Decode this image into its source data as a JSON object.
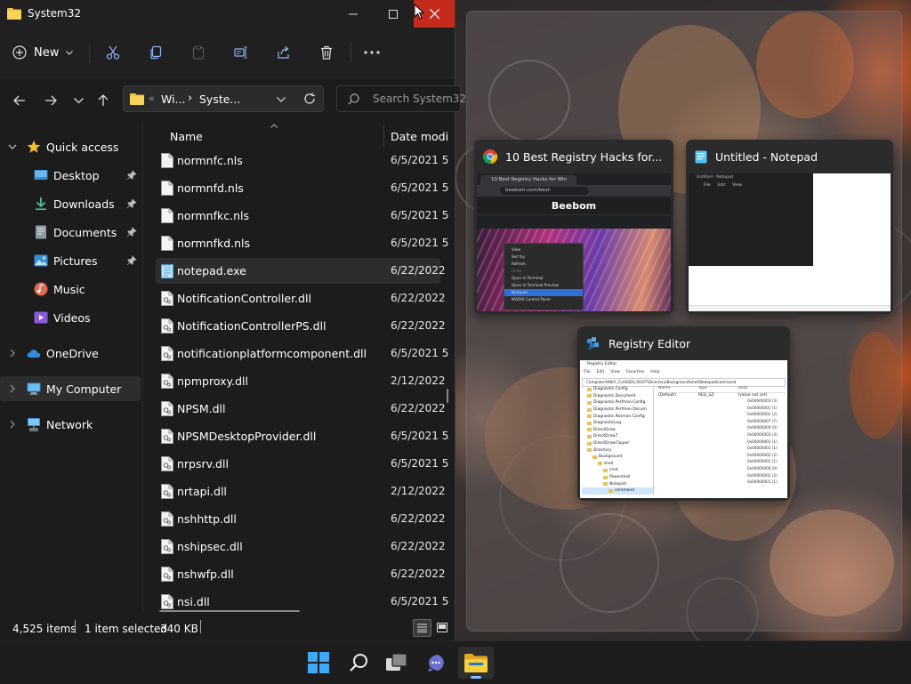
{
  "window": {
    "title": "System32"
  },
  "toolbar": {
    "new_label": "New"
  },
  "address": {
    "overflow": "«",
    "part1": "Wi...",
    "separator": "›",
    "part2": "Syste..."
  },
  "search": {
    "placeholder": "Search System32"
  },
  "nav": {
    "quick_access": "Quick access",
    "items": [
      {
        "label": "Desktop",
        "pinned": true
      },
      {
        "label": "Downloads",
        "pinned": true
      },
      {
        "label": "Documents",
        "pinned": true
      },
      {
        "label": "Pictures",
        "pinned": true
      },
      {
        "label": "Music",
        "pinned": false
      },
      {
        "label": "Videos",
        "pinned": false
      }
    ],
    "onedrive": "OneDrive",
    "my_computer": "My Computer",
    "network": "Network"
  },
  "columns": {
    "name": "Name",
    "date": "Date modi"
  },
  "files": [
    {
      "name": "normnfc.nls",
      "date": "6/5/2021 5",
      "type": "doc"
    },
    {
      "name": "normnfd.nls",
      "date": "6/5/2021 5",
      "type": "doc"
    },
    {
      "name": "normnfkc.nls",
      "date": "6/5/2021 5",
      "type": "doc"
    },
    {
      "name": "normnfkd.nls",
      "date": "6/5/2021 5",
      "type": "doc"
    },
    {
      "name": "notepad.exe",
      "date": "6/22/2022",
      "type": "exe",
      "selected": true
    },
    {
      "name": "NotificationController.dll",
      "date": "6/22/2022",
      "type": "dll"
    },
    {
      "name": "NotificationControllerPS.dll",
      "date": "6/22/2022",
      "type": "dll"
    },
    {
      "name": "notificationplatformcomponent.dll",
      "date": "6/5/2021 5",
      "type": "dll"
    },
    {
      "name": "npmproxy.dll",
      "date": "2/12/2022",
      "type": "dll"
    },
    {
      "name": "NPSM.dll",
      "date": "6/22/2022",
      "type": "dll"
    },
    {
      "name": "NPSMDesktopProvider.dll",
      "date": "6/5/2021 5",
      "type": "dll"
    },
    {
      "name": "nrpsrv.dll",
      "date": "6/5/2021 5",
      "type": "dll"
    },
    {
      "name": "nrtapi.dll",
      "date": "2/12/2022",
      "type": "dll"
    },
    {
      "name": "nshhttp.dll",
      "date": "6/22/2022",
      "type": "dll"
    },
    {
      "name": "nshipsec.dll",
      "date": "6/22/2022",
      "type": "dll"
    },
    {
      "name": "nshwfp.dll",
      "date": "6/22/2022",
      "type": "dll"
    },
    {
      "name": "nsi.dll",
      "date": "6/5/2021 5",
      "type": "dll"
    }
  ],
  "status": {
    "items": "4,525 items",
    "selected": "1 item selected",
    "size": "340 KB"
  },
  "snap": {
    "chrome_title": "10 Best Registry Hacks for...",
    "chrome_tab": "10 Best Registry Hacks for Win",
    "chrome_url": "beebom.com/best-",
    "chrome_site": "Beebom",
    "chrome_menu": [
      "View",
      "Sort by",
      "Refresh",
      "Undo",
      "Open in Terminal",
      "Open in Terminal Preview",
      "Notepad",
      "NVIDIA Control Panel"
    ],
    "notepad_title": "Untitled - Notepad",
    "notepad_inner_title": "Untitled - Notepad",
    "notepad_menu": [
      "File",
      "Edit",
      "View"
    ],
    "registry_title": "Registry Editor",
    "registry_inner_title": "Registry Editor",
    "registry_menu": [
      "File",
      "Edit",
      "View",
      "Favorites",
      "Help"
    ],
    "registry_path": "Computer\\HKEY_CLASSES_ROOT\\Directory\\Background\\shell\\Notepad\\command",
    "registry_tree": [
      "Diagnostic.Config",
      "Diagnostic.Document",
      "Diagnostic.Perfmon.Config",
      "Diagnostic.Perfmon.Docum",
      "Diagnostic.Resmon.Config",
      "DiagnosticLog",
      "DirectDraw",
      "DirectDraw7",
      "DirectDrawClipper",
      "Directory",
      "Background",
      "shell",
      "cmd",
      "Powershell",
      "Notepad",
      "command"
    ],
    "registry_cols": [
      "Name",
      "Type",
      "Data"
    ],
    "registry_row": [
      "(Default)",
      "REG_SZ",
      "(value not set)"
    ],
    "registry_values": [
      "0x00000003 (3)",
      "0x00000001 (1)",
      "0x00000002 (2)",
      "0x00000007 (7)",
      "0x00000000 (0)",
      "0x00000003 (3)",
      "0x00000001 (1)",
      "0x00000001 (1)",
      "0x00000002 (2)",
      "0x00000001 (1)",
      "0x00000000 (0)",
      "0x00000002 (2)",
      "0x00000001 (1)"
    ]
  }
}
